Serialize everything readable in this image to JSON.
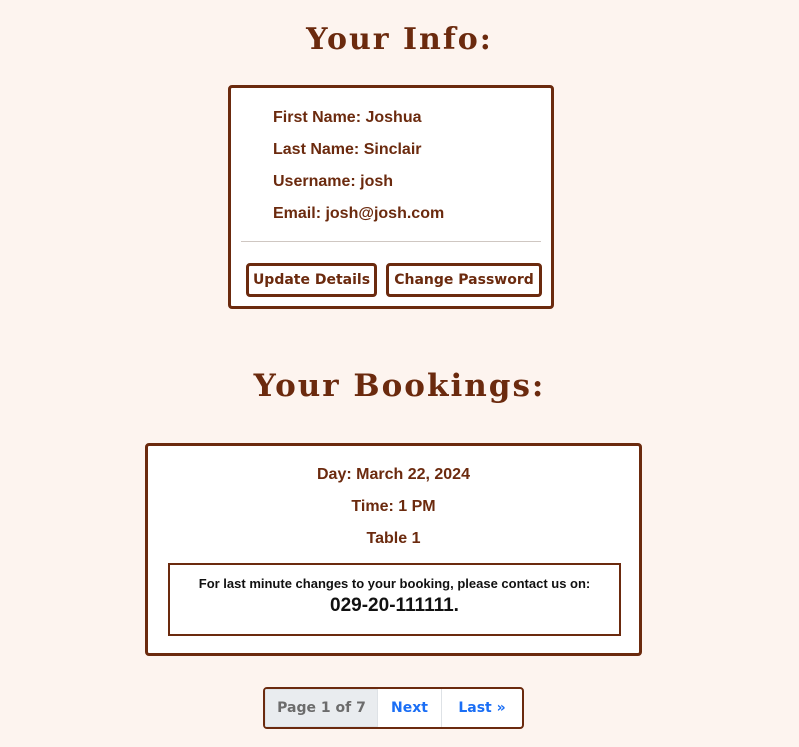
{
  "info": {
    "heading": "Your Info:",
    "fields": [
      {
        "text": "First Name: Joshua"
      },
      {
        "text": "Last Name: Sinclair"
      },
      {
        "text": "Username: josh"
      },
      {
        "text": "Email: josh@josh.com"
      }
    ],
    "update_label": "Update Details",
    "password_label": "Change Password"
  },
  "bookings": {
    "heading": "Your Bookings:",
    "day": "Day: March 22, 2024",
    "time": "Time: 1 PM",
    "table": "Table 1",
    "notice_text": "For last minute changes to your booking, please contact us on:",
    "notice_phone": "029-20-111111."
  },
  "pagination": {
    "current": "Page 1 of 7",
    "next": "Next",
    "last": "Last »"
  },
  "colors": {
    "brand": "#6b2a0e",
    "background": "#fdf4ef",
    "link": "#1a6ef5"
  }
}
